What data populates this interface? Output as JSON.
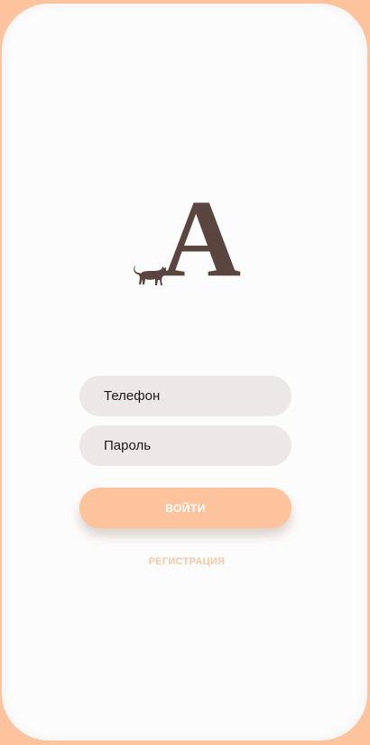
{
  "logo": {
    "letter": "A",
    "icon": "cat-icon",
    "color": "#5a4540"
  },
  "form": {
    "phone_placeholder": "Телефон",
    "password_placeholder": "Пароль",
    "login_label": "ВОЙТИ",
    "register_label": "РЕГИСТРАЦИЯ"
  },
  "colors": {
    "accent": "#fcc39d",
    "field_bg": "#ece8e7"
  }
}
